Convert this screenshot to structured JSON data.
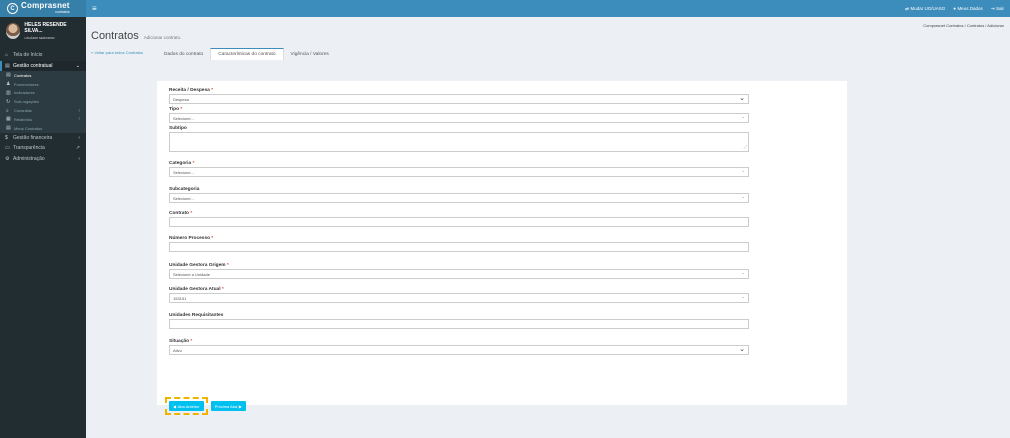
{
  "app": {
    "logo_glyph": "C",
    "logo_title": "Comprasnet",
    "logo_subtitle": "contratos",
    "menu_glyph": "≡"
  },
  "topbar": {
    "change_ug": "Mudar UG/UASG",
    "my_data": "Meus Dados",
    "logout": "Sair"
  },
  "user": {
    "name": "HELES RESENDE SILVA...",
    "role": "USUÁRIO SERVIDOR"
  },
  "sidebar": {
    "home": "Tela de Início",
    "contract_mgmt": "Gestão contratual",
    "contracts": "Contratos",
    "suppliers": "Fornecedores",
    "indicators": "Indicadores",
    "subrogations": "Sub-rogações",
    "queries": "Consultas",
    "reports": "Relatórios",
    "my_contracts": "Meus Contratos",
    "financial_mgmt": "Gestão financeira",
    "transparency": "Transparência",
    "administration": "Administração"
  },
  "page": {
    "title": "Contratos",
    "subtitle": "Adicionar contrato.",
    "back_link": "« Voltar para todos Contratos",
    "breadcrumb": "Comprasnet Contratos  /  Contratos  /  Adicionar"
  },
  "tabs": {
    "contract_data": "Dados do contrato",
    "characteristics": "Características do contrato",
    "validity": "Vigência / Valores"
  },
  "form": {
    "receita_label": "Receita / Despesa",
    "receita_value": "Despesa",
    "tipo_label": "Tipo",
    "tipo_value": "Selecione...",
    "subtipo_label": "Subtipo",
    "categoria_label": "Categoria",
    "categoria_value": "Selecione...",
    "subcategoria_label": "Subcategoria",
    "subcategoria_value": "Selecione...",
    "contrato_label": "Contrato",
    "processo_label": "Número Processo",
    "ug_origem_label": "Unidade Gestora Origem",
    "ug_origem_value": "Selecione a Unidade",
    "ug_atual_label": "Unidade Gestora Atual",
    "ug_atual_value": "153151",
    "requisitantes_label": "Unidades Requisitantes",
    "situacao_label": "Situação",
    "situacao_value": "Ativo",
    "required_mark": "*"
  },
  "buttons": {
    "previous": "Aba Anterior",
    "next": "Próxima Aba"
  }
}
